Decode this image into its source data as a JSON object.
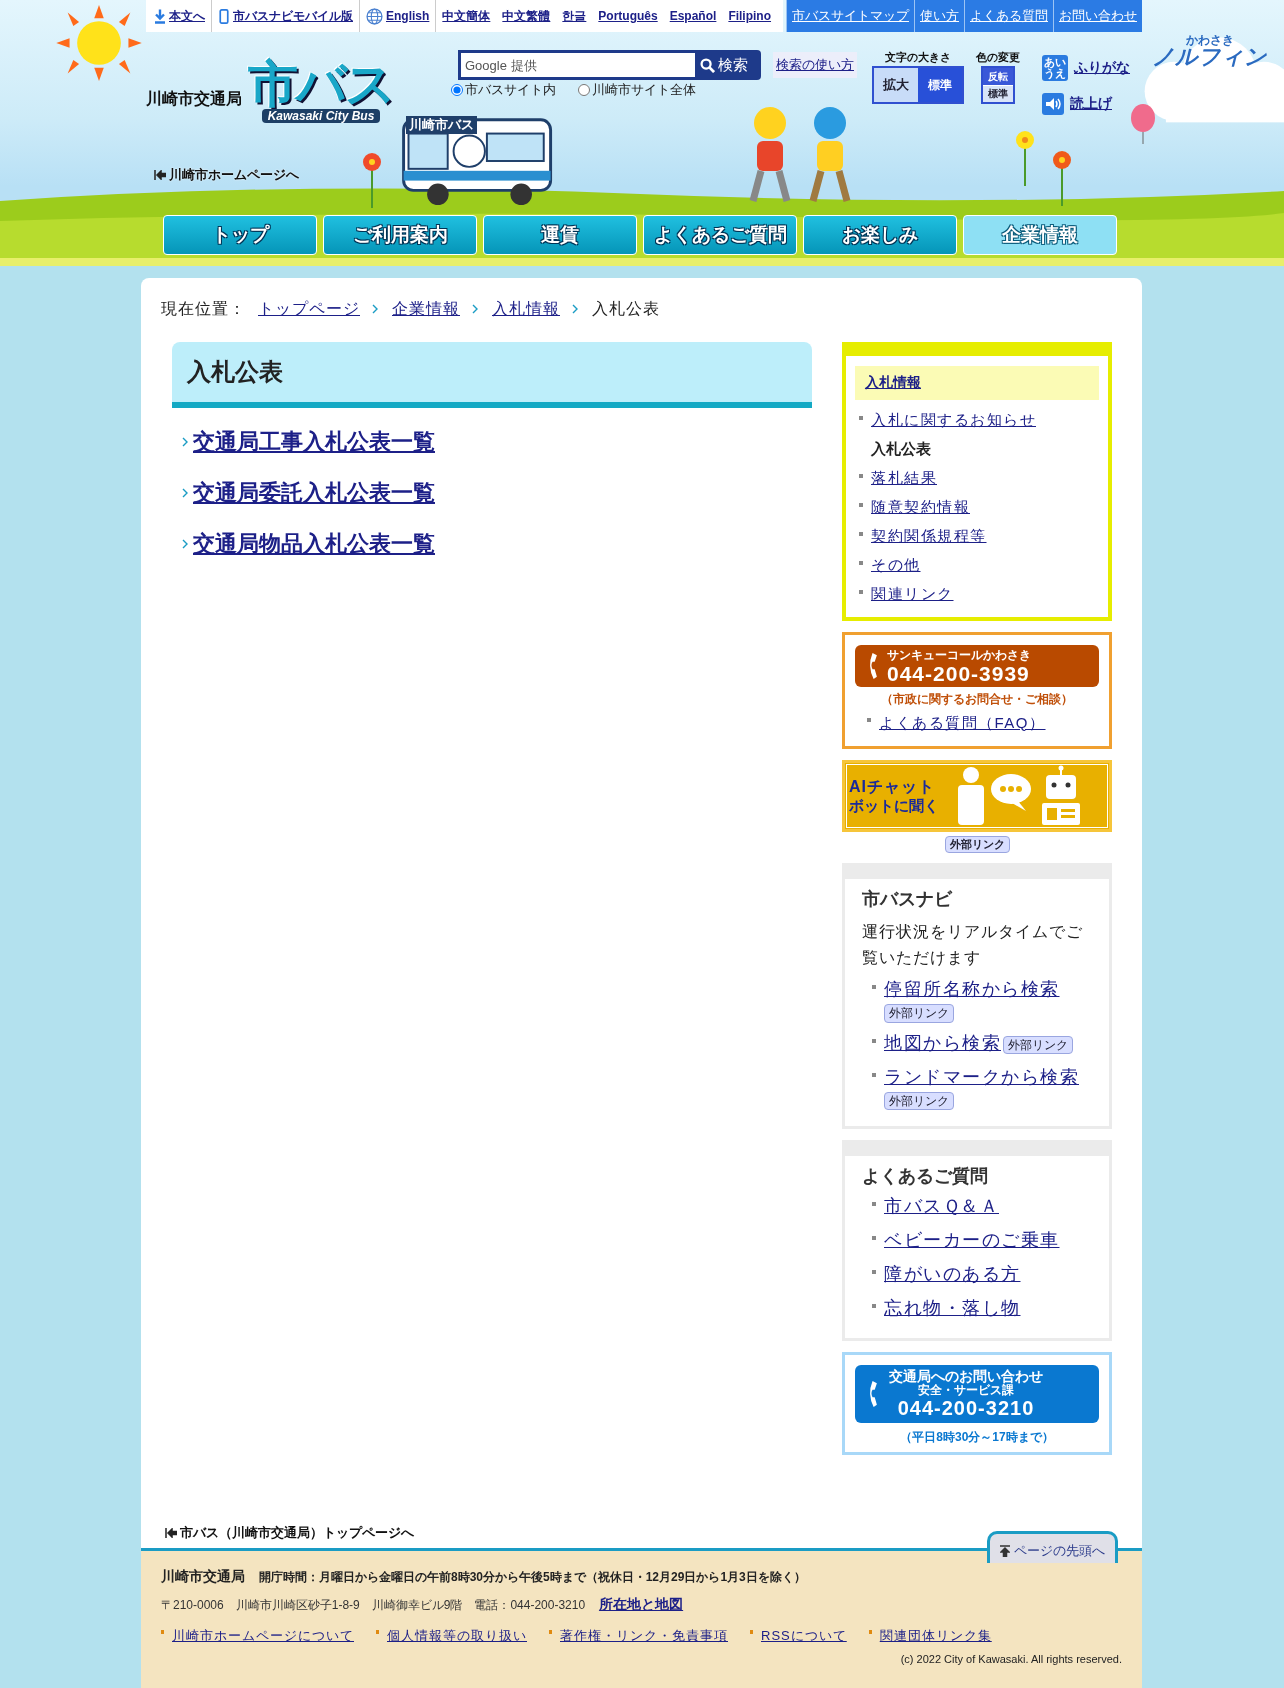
{
  "top_links": [
    {
      "kind": "skip",
      "label": "本文へ"
    },
    {
      "kind": "mobile",
      "label": "市バスナビモバイル版"
    },
    {
      "kind": "globe",
      "label": "English"
    },
    {
      "kind": "plain",
      "label": "中文簡体"
    },
    {
      "kind": "plain",
      "label": "中文繁體"
    },
    {
      "kind": "plain",
      "label": "한글"
    },
    {
      "kind": "plain",
      "label": "Português"
    },
    {
      "kind": "plain",
      "label": "Español"
    },
    {
      "kind": "plain",
      "label": "Filipino"
    }
  ],
  "utility_links": [
    "市バスサイトマップ",
    "使い方",
    "よくある質問",
    "お問い合わせ"
  ],
  "header": {
    "org": "川崎市交通局",
    "logo_title": "市バス",
    "logo_subtitle": "Kawasaki City Bus",
    "home_link": "川崎市ホームページへ",
    "bus_sign": "川崎市バス",
    "search": {
      "placeholder": "Google 提供",
      "button": "検索",
      "help": "検索の使い方",
      "scopes": [
        {
          "label": "市バスサイト内",
          "selected": true
        },
        {
          "label": "川崎市サイト全体",
          "selected": false
        }
      ]
    },
    "text_size": {
      "label": "文字の大きさ",
      "buttons": [
        "拡大",
        "標準"
      ]
    },
    "color_change": {
      "label": "色の変更",
      "buttons": [
        "反転",
        "標準"
      ]
    },
    "furigana": {
      "icon": "あいうえ",
      "label": "ふりがな"
    },
    "read_aloud": "読上げ",
    "mascot": {
      "small": "かわさき",
      "name": "ノルフィン"
    }
  },
  "nav": [
    {
      "label": "トップ",
      "selected": false
    },
    {
      "label": "ご利用案内",
      "selected": false
    },
    {
      "label": "運賃",
      "selected": false
    },
    {
      "label": "よくあるご質問",
      "selected": false
    },
    {
      "label": "お楽しみ",
      "selected": false
    },
    {
      "label": "企業情報",
      "selected": true
    }
  ],
  "breadcrumb": {
    "label": "現在位置：",
    "links": [
      "トップページ",
      "企業情報",
      "入札情報"
    ],
    "current": "入札公表"
  },
  "page_title": "入札公表",
  "links": [
    "交通局工事入札公表一覧",
    "交通局委託入札公表一覧",
    "交通局物品入札公表一覧"
  ],
  "sidebar": {
    "section": {
      "heading": "入札情報",
      "items": [
        {
          "label": "入札に関するお知らせ",
          "current": false
        },
        {
          "label": "入札公表",
          "current": true
        },
        {
          "label": "落札結果",
          "current": false
        },
        {
          "label": "随意契約情報",
          "current": false
        },
        {
          "label": "契約関係規程等",
          "current": false
        },
        {
          "label": "その他",
          "current": false
        },
        {
          "label": "関連リンク",
          "current": false
        }
      ]
    },
    "call_center": {
      "title": "サンキューコールかわさき",
      "phone": "044-200-3939",
      "note": "（市政に関するお問合せ・ご相談）",
      "link": "よくある質問（FAQ）"
    },
    "ai_banner": {
      "line1": "AIチャット",
      "line2": "ボットに聞く",
      "badge": "外部リンク"
    },
    "navi": {
      "heading": "市バスナビ",
      "text": "運行状況をリアルタイムでご覧いただけます",
      "links": [
        {
          "label": "停留所名称から検索",
          "badge": "外部リンク"
        },
        {
          "label": "地図から検索",
          "badge": "外部リンク"
        },
        {
          "label": "ランドマークから検索",
          "badge": "外部リンク"
        }
      ]
    },
    "faq": {
      "heading": "よくあるご質問",
      "links": [
        "市バスＱ＆Ａ",
        "ベビーカーのご乗車",
        "障がいのある方",
        "忘れ物・落し物"
      ]
    },
    "contact": {
      "title": "交通局へのお問い合わせ",
      "dept": "安全・サービス課",
      "phone": "044-200-3210",
      "hours": "（平日8時30分～17時まで）"
    }
  },
  "footer": {
    "top_link": "市バス（川崎市交通局）トップページへ",
    "page_top": "ページの先頭へ",
    "org": "川崎市交通局",
    "hours": "開庁時間：月曜日から金曜日の午前8時30分から午後5時まで（祝休日・12月29日から1月3日を除く）",
    "address": "〒210-0006　川崎市川崎区砂子1-8-9　川崎御幸ビル9階　電話：044-200-3210",
    "map_link": "所在地と地図",
    "links": [
      "川崎市ホームページについて",
      "個人情報等の取り扱い",
      "著作権・リンク・免責事項",
      "RSSについて",
      "関連団体リンク集"
    ],
    "copyright": "(c) 2022 City of Kawasaki. All rights reserved."
  }
}
